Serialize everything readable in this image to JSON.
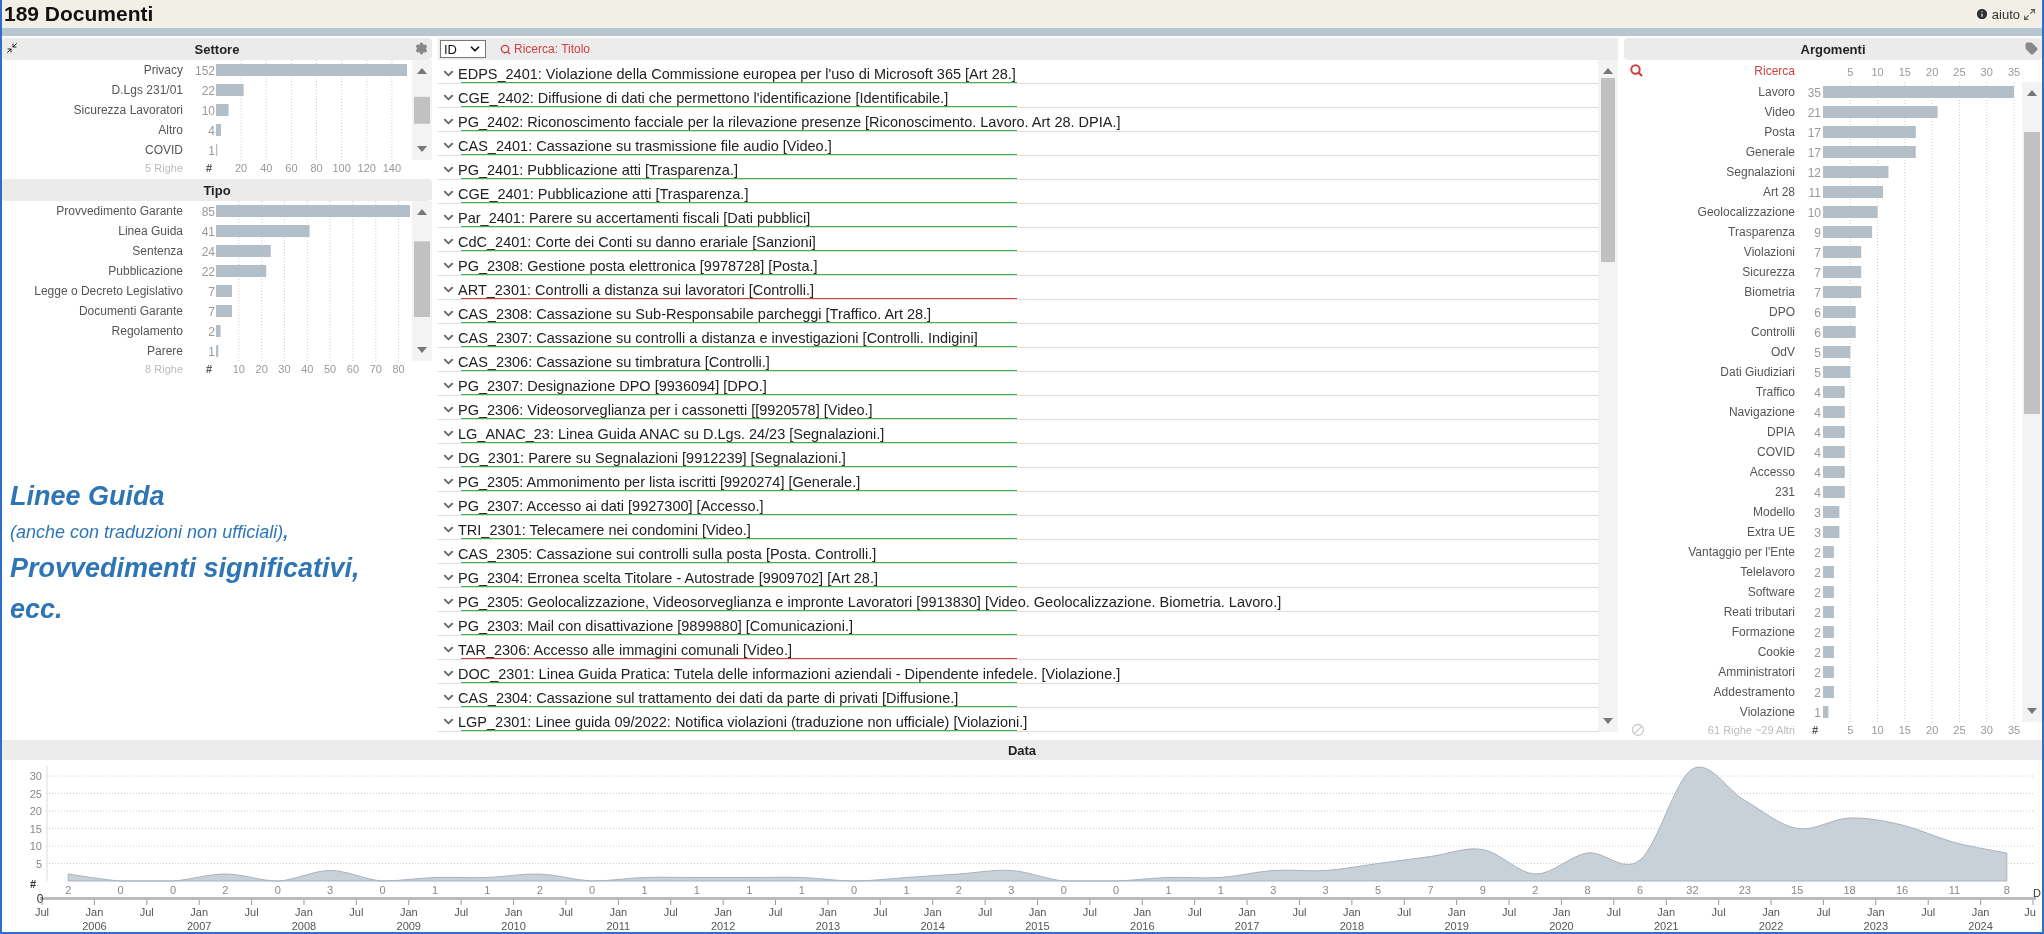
{
  "header": {
    "title": "189 Documenti",
    "help_label": "aiuto"
  },
  "facets_left": [
    {
      "title": "Settore",
      "footer": "5 Righe",
      "axis_label": "#",
      "chart_data": {
        "type": "bar",
        "orientation": "horizontal",
        "categories": [
          "Privacy",
          "D.Lgs 231/01",
          "Sicurezza Lavoratori",
          "Altro",
          "COVID"
        ],
        "values": [
          152,
          22,
          10,
          4,
          1
        ],
        "xlim": [
          0,
          152
        ],
        "grid": true,
        "xticks": [
          20,
          40,
          60,
          80,
          100,
          120,
          140
        ],
        "data_labels": true
      }
    },
    {
      "title": "Tipo",
      "footer": "8 Righe",
      "axis_label": "#",
      "chart_data": {
        "type": "bar",
        "orientation": "horizontal",
        "categories": [
          "Provvedimento Garante",
          "Linea Guida",
          "Sentenza",
          "Pubblicazione",
          "Legge o Decreto Legislativo",
          "Documenti Garante",
          "Regolamento",
          "Parere"
        ],
        "values": [
          85,
          41,
          24,
          22,
          7,
          7,
          2,
          1
        ],
        "xlim": [
          0,
          85
        ],
        "grid": true,
        "xticks": [
          10,
          20,
          30,
          40,
          50,
          60,
          70,
          80
        ],
        "data_labels": true
      }
    }
  ],
  "annotation": {
    "lines": [
      {
        "kind": "heading",
        "text": "Linee Guida"
      },
      {
        "kind": "note",
        "text": "(anche con traduzioni non ufficiali)**,**"
      },
      {
        "kind": "heading",
        "text": "Provvedimenti significativi,"
      },
      {
        "kind": "heading",
        "text": "ecc."
      }
    ]
  },
  "list": {
    "sort_select": "ID",
    "search_hint": "Ricerca: Titolo",
    "rows": [
      {
        "text": "EDPS_2401: Violazione della Commissione europea per l'uso di Microsoft 365 [Art 28.]",
        "color": "#3cb44b"
      },
      {
        "text": "CGE_2402: Diffusione di dati che permettono l'identificazione [Identificabile.]",
        "color": "#3cb44b"
      },
      {
        "text": "PG_2402: Riconoscimento facciale per la rilevazione presenze [Riconoscimento. Lavoro. Art 28. DPIA.]",
        "color": "#3cb44b"
      },
      {
        "text": "CAS_2401: Cassazione su trasmissione file audio [Video.]",
        "color": "#3cb44b"
      },
      {
        "text": "PG_2401: Pubblicazione atti [Trasparenza.]",
        "color": "#3cb44b"
      },
      {
        "text": "CGE_2401: Pubblicazione atti [Trasparenza.]",
        "color": "#3cb44b"
      },
      {
        "text": "Par_2401: Parere su accertamenti fiscali [Dati pubblici]",
        "color": "#3cb44b"
      },
      {
        "text": "CdC_2401: Corte dei Conti su danno erariale [Sanzioni]",
        "color": "#3cb44b"
      },
      {
        "text": "PG_2308: Gestione posta elettronica [9978728] [Posta.]",
        "color": "#3cb44b"
      },
      {
        "text": "ART_2301: Controlli a distanza sui lavoratori [Controlli.]",
        "color": "#e03c3c"
      },
      {
        "text": "CAS_2308: Cassazione su Sub-Responsabile parcheggi [Traffico. Art 28.]",
        "color": "#3cb44b"
      },
      {
        "text": "CAS_2307: Cassazione su controlli a distanza e investigazioni [Controlli. Indigini]",
        "color": "#3cb44b"
      },
      {
        "text": "CAS_2306: Cassazione su timbratura [Controlli.]",
        "color": "#3cb44b"
      },
      {
        "text": "PG_2307: Designazione DPO [9936094] [DPO.]",
        "color": "#3cb44b"
      },
      {
        "text": "PG_2306: Videosorveglianza per i cassonetti [[9920578] [Video.]",
        "color": "#3cb44b"
      },
      {
        "text": "LG_ANAC_23: Linea Guida ANAC su D.Lgs. 24/23 [Segnalazioni.]",
        "color": "#3cb44b"
      },
      {
        "text": "DG_2301: Parere su Segnalazioni [9912239] [Segnalazioni.]",
        "color": "#3cb44b"
      },
      {
        "text": "PG_2305: Ammonimento per lista iscritti [9920274] [Generale.]",
        "color": "#3cb44b"
      },
      {
        "text": "PG_2307: Accesso ai dati [9927300] [Accesso.]",
        "color": "#3cb44b"
      },
      {
        "text": "TRI_2301: Telecamere nei condomini [Video.]",
        "color": "#3cb44b"
      },
      {
        "text": "CAS_2305: Cassazione sui controlli sulla posta [Posta. Controlli.]",
        "color": "#3cb44b"
      },
      {
        "text": "PG_2304: Erronea scelta Titolare - Autostrade [9909702] [Art 28.]",
        "color": "#3cb44b"
      },
      {
        "text": "PG_2305: Geolocalizzazione, Videosorveglianza e impronte Lavoratori [9913830] [Video. Geolocalizzazione. Biometria. Lavoro.]",
        "color": "#3cb44b"
      },
      {
        "text": "PG_2303: Mail con disattivazione [9899880] [Comunicazioni.]",
        "color": "#3cb44b"
      },
      {
        "text": "TAR_2306: Accesso alle immagini comunali [Video.]",
        "color": "#e03c3c"
      },
      {
        "text": "DOC_2301: Linea Guida Pratica: Tutela delle informazioni aziendali - Dipendente infedele. [Violazione.]",
        "color": "#3cb44b"
      },
      {
        "text": "CAS_2304: Cassazione sul trattamento dei dati da parte di privati [Diffusione.]",
        "color": "#3cb44b"
      },
      {
        "text": "LGP_2301: Linee guida 09/2022: Notifica violazioni (traduzione non ufficiale) [Violazioni.]",
        "color": "#3cb44b"
      }
    ]
  },
  "argomenti": {
    "title": "Argomenti",
    "search_label": "Ricerca",
    "top_ticks": [
      "5",
      "10",
      "15",
      "20",
      "25",
      "30",
      "35"
    ],
    "footer": "61 Righe ~29 Altri",
    "axis_label": "#",
    "chart_data": {
      "type": "bar",
      "orientation": "horizontal",
      "categories": [
        "Lavoro",
        "Video",
        "Posta",
        "Generale",
        "Segnalazioni",
        "Art 28",
        "Geolocalizzazione",
        "Trasparenza",
        "Violazioni",
        "Sicurezza",
        "Biometria",
        "DPO",
        "Controlli",
        "OdV",
        "Dati Giudiziari",
        "Traffico",
        "Navigazione",
        "DPIA",
        "COVID",
        "Accesso",
        "231",
        "Modello",
        "Extra UE",
        "Vantaggio per l'Ente",
        "Telelavoro",
        "Software",
        "Reati tributari",
        "Formazione",
        "Cookie",
        "Amministratori",
        "Addestramento",
        "Violazione"
      ],
      "values": [
        35,
        21,
        17,
        17,
        12,
        11,
        10,
        9,
        7,
        7,
        7,
        6,
        6,
        5,
        5,
        4,
        4,
        4,
        4,
        4,
        4,
        3,
        3,
        2,
        2,
        2,
        2,
        2,
        2,
        2,
        2,
        1
      ],
      "xlim": [
        0,
        35
      ],
      "grid": true,
      "xticks": [
        5,
        10,
        15,
        20,
        25,
        30,
        35
      ],
      "data_labels": true
    }
  },
  "timeline": {
    "title": "Data",
    "axis_label": "#",
    "origin_label": "0",
    "edge_label": "D",
    "chart_data": {
      "type": "area",
      "categories": [
        null,
        null,
        null,
        null,
        null,
        null,
        null,
        null,
        null,
        null,
        null,
        null,
        null,
        null,
        null,
        null,
        null,
        null,
        null,
        null,
        null,
        null,
        null,
        null,
        null,
        null,
        null,
        null,
        null,
        null,
        null,
        null,
        null,
        null,
        null,
        null,
        null,
        null
      ],
      "grid": true,
      "values": [
        2,
        0,
        0,
        2,
        0,
        3,
        0,
        1,
        1,
        2,
        0,
        1,
        1,
        1,
        1,
        0,
        1,
        2,
        3,
        0,
        0,
        1,
        1,
        3,
        3,
        5,
        7,
        9,
        2,
        8,
        6,
        32,
        23,
        15,
        18,
        16,
        11,
        8
      ],
      "ylim": [
        0,
        33
      ],
      "yticks": [
        5,
        10,
        15,
        20,
        25,
        30
      ],
      "data_labels": true
    },
    "time_axis": [
      "Jul",
      "Jan\n2006",
      "Jul",
      "Jan\n2007",
      "Jul",
      "Jan\n2008",
      "Jul",
      "Jan\n2009",
      "Jul",
      "Jan\n2010",
      "Jul",
      "Jan\n2011",
      "Jul",
      "Jan\n2012",
      "Jul",
      "Jan\n2013",
      "Jul",
      "Jan\n2014",
      "Jul",
      "Jan\n2015",
      "Jul",
      "Jan\n2016",
      "Jul",
      "Jan\n2017",
      "Jul",
      "Jan\n2018",
      "Jul",
      "Jan\n2019",
      "Jul",
      "Jan\n2020",
      "Jul",
      "Jan\n2021",
      "Jul",
      "Jan\n2022",
      "Jul",
      "Jan\n2023",
      "Jul",
      "Jan\n2024",
      "Ju"
    ]
  }
}
